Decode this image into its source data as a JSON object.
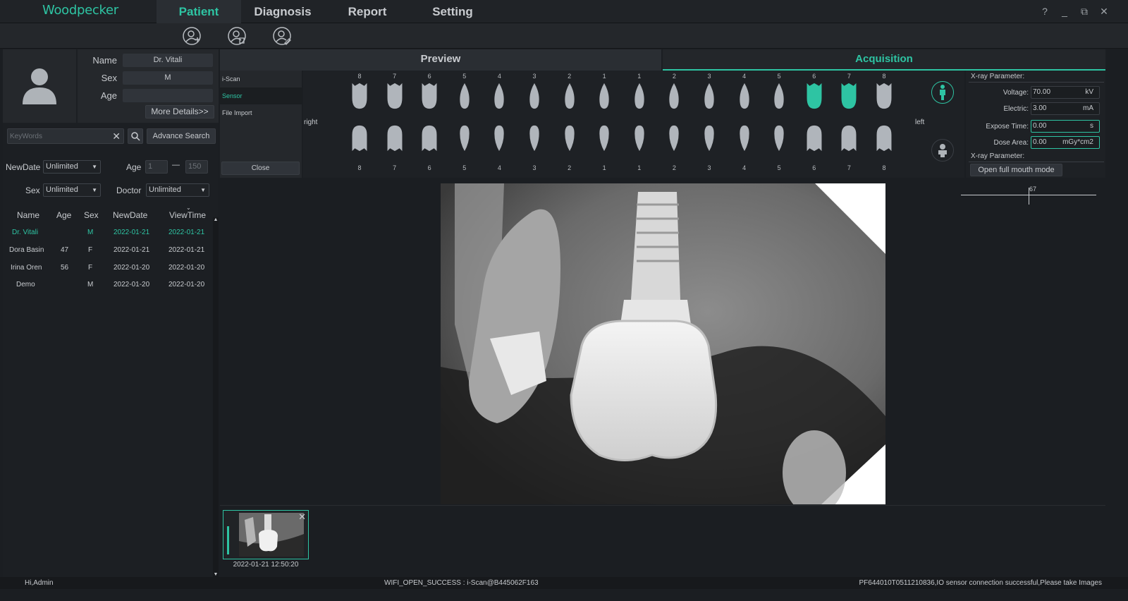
{
  "app": {
    "logo": "Woodpecker"
  },
  "menu": [
    "Patient",
    "Diagnosis",
    "Report",
    "Setting"
  ],
  "window_controls": [
    "?",
    "_",
    "⧉",
    "✕"
  ],
  "toolbar_icons": [
    "add-patient-icon",
    "delete-patient-icon",
    "edit-patient-icon"
  ],
  "patient": {
    "name_label": "Name",
    "name": "Dr. Vitali",
    "sex_label": "Sex",
    "sex": "M",
    "age_label": "Age",
    "age": "",
    "more_details": "More Details>>"
  },
  "search": {
    "placeholder": "KeyWords",
    "advance": "Advance Search"
  },
  "filters": {
    "newdate_label": "NewDate",
    "newdate": "Unlimited",
    "age_label": "Age",
    "age_from": "1",
    "age_sep": "—",
    "age_to": "150",
    "sex_label": "Sex",
    "sex": "Unlimited",
    "doctor_label": "Doctor",
    "doctor": "Unlimited"
  },
  "table": {
    "headers": [
      "Name",
      "Age",
      "Sex",
      "NewDate",
      "ViewTime"
    ],
    "rows": [
      [
        "Dr. Vitali",
        "",
        "M",
        "2022-01-21",
        "2022-01-21"
      ],
      [
        "Dora Basin",
        "47",
        "F",
        "2022-01-21",
        "2022-01-21"
      ],
      [
        "Irina Oren",
        "56",
        "F",
        "2022-01-20",
        "2022-01-20"
      ],
      [
        "Demo",
        "",
        "M",
        "2022-01-20",
        "2022-01-20"
      ]
    ]
  },
  "main_tabs": [
    "Preview",
    "Acquisition"
  ],
  "sources": [
    "i-Scan",
    "Sensor",
    "File Import"
  ],
  "close_button": "Close",
  "tooth_chart": {
    "right_label": "right",
    "left_label": "left",
    "numbers": [
      "8",
      "7",
      "6",
      "5",
      "4",
      "3",
      "2",
      "1",
      "1",
      "2",
      "3",
      "4",
      "5",
      "6",
      "7",
      "8"
    ],
    "selected_upper_left": [
      "6",
      "7"
    ]
  },
  "xray_params": {
    "header": "X-ray Parameter:",
    "voltage_label": "Voltage:",
    "voltage": "70.00",
    "voltage_unit": "kV",
    "electric_label": "Electric:",
    "electric": "3.00",
    "electric_unit": "mA",
    "expose_label": "Expose Time:",
    "expose": "0.00",
    "expose_unit": "s",
    "dose_label": "Dose Area:",
    "dose": "0.00",
    "dose_unit": "mGy*cm2",
    "header2": "X-ray Parameter:",
    "full_mouth": "Open full mouth mode"
  },
  "position_marker": "67",
  "thumbnail": {
    "timestamp": "2022-01-21 12:50:20"
  },
  "status": {
    "user": "Hi,Admin",
    "wifi": "WIFI_OPEN_SUCCESS : i-Scan@B445062F163",
    "sensor": "PF644010T0511210836,IO sensor connection successful,Please take Images"
  },
  "colors": {
    "accent": "#2ec4a3",
    "background": "#1b1e22",
    "panel": "#25282c"
  }
}
